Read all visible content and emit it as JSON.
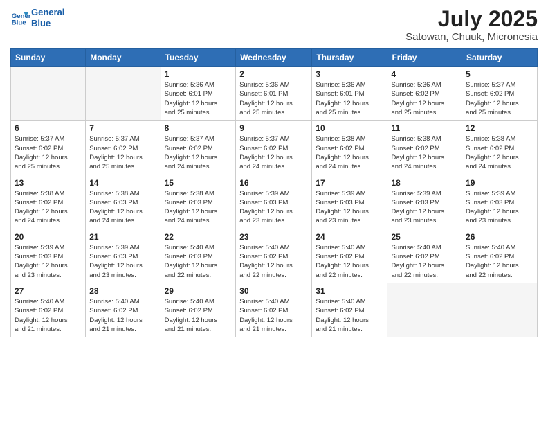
{
  "header": {
    "logo_line1": "General",
    "logo_line2": "Blue",
    "title": "July 2025",
    "subtitle": "Satowan, Chuuk, Micronesia"
  },
  "weekdays": [
    "Sunday",
    "Monday",
    "Tuesday",
    "Wednesday",
    "Thursday",
    "Friday",
    "Saturday"
  ],
  "weeks": [
    [
      {
        "day": "",
        "info": ""
      },
      {
        "day": "",
        "info": ""
      },
      {
        "day": "1",
        "info": "Sunrise: 5:36 AM\nSunset: 6:01 PM\nDaylight: 12 hours\nand 25 minutes."
      },
      {
        "day": "2",
        "info": "Sunrise: 5:36 AM\nSunset: 6:01 PM\nDaylight: 12 hours\nand 25 minutes."
      },
      {
        "day": "3",
        "info": "Sunrise: 5:36 AM\nSunset: 6:01 PM\nDaylight: 12 hours\nand 25 minutes."
      },
      {
        "day": "4",
        "info": "Sunrise: 5:36 AM\nSunset: 6:02 PM\nDaylight: 12 hours\nand 25 minutes."
      },
      {
        "day": "5",
        "info": "Sunrise: 5:37 AM\nSunset: 6:02 PM\nDaylight: 12 hours\nand 25 minutes."
      }
    ],
    [
      {
        "day": "6",
        "info": "Sunrise: 5:37 AM\nSunset: 6:02 PM\nDaylight: 12 hours\nand 25 minutes."
      },
      {
        "day": "7",
        "info": "Sunrise: 5:37 AM\nSunset: 6:02 PM\nDaylight: 12 hours\nand 25 minutes."
      },
      {
        "day": "8",
        "info": "Sunrise: 5:37 AM\nSunset: 6:02 PM\nDaylight: 12 hours\nand 24 minutes."
      },
      {
        "day": "9",
        "info": "Sunrise: 5:37 AM\nSunset: 6:02 PM\nDaylight: 12 hours\nand 24 minutes."
      },
      {
        "day": "10",
        "info": "Sunrise: 5:38 AM\nSunset: 6:02 PM\nDaylight: 12 hours\nand 24 minutes."
      },
      {
        "day": "11",
        "info": "Sunrise: 5:38 AM\nSunset: 6:02 PM\nDaylight: 12 hours\nand 24 minutes."
      },
      {
        "day": "12",
        "info": "Sunrise: 5:38 AM\nSunset: 6:02 PM\nDaylight: 12 hours\nand 24 minutes."
      }
    ],
    [
      {
        "day": "13",
        "info": "Sunrise: 5:38 AM\nSunset: 6:02 PM\nDaylight: 12 hours\nand 24 minutes."
      },
      {
        "day": "14",
        "info": "Sunrise: 5:38 AM\nSunset: 6:03 PM\nDaylight: 12 hours\nand 24 minutes."
      },
      {
        "day": "15",
        "info": "Sunrise: 5:38 AM\nSunset: 6:03 PM\nDaylight: 12 hours\nand 24 minutes."
      },
      {
        "day": "16",
        "info": "Sunrise: 5:39 AM\nSunset: 6:03 PM\nDaylight: 12 hours\nand 23 minutes."
      },
      {
        "day": "17",
        "info": "Sunrise: 5:39 AM\nSunset: 6:03 PM\nDaylight: 12 hours\nand 23 minutes."
      },
      {
        "day": "18",
        "info": "Sunrise: 5:39 AM\nSunset: 6:03 PM\nDaylight: 12 hours\nand 23 minutes."
      },
      {
        "day": "19",
        "info": "Sunrise: 5:39 AM\nSunset: 6:03 PM\nDaylight: 12 hours\nand 23 minutes."
      }
    ],
    [
      {
        "day": "20",
        "info": "Sunrise: 5:39 AM\nSunset: 6:03 PM\nDaylight: 12 hours\nand 23 minutes."
      },
      {
        "day": "21",
        "info": "Sunrise: 5:39 AM\nSunset: 6:03 PM\nDaylight: 12 hours\nand 23 minutes."
      },
      {
        "day": "22",
        "info": "Sunrise: 5:40 AM\nSunset: 6:03 PM\nDaylight: 12 hours\nand 22 minutes."
      },
      {
        "day": "23",
        "info": "Sunrise: 5:40 AM\nSunset: 6:02 PM\nDaylight: 12 hours\nand 22 minutes."
      },
      {
        "day": "24",
        "info": "Sunrise: 5:40 AM\nSunset: 6:02 PM\nDaylight: 12 hours\nand 22 minutes."
      },
      {
        "day": "25",
        "info": "Sunrise: 5:40 AM\nSunset: 6:02 PM\nDaylight: 12 hours\nand 22 minutes."
      },
      {
        "day": "26",
        "info": "Sunrise: 5:40 AM\nSunset: 6:02 PM\nDaylight: 12 hours\nand 22 minutes."
      }
    ],
    [
      {
        "day": "27",
        "info": "Sunrise: 5:40 AM\nSunset: 6:02 PM\nDaylight: 12 hours\nand 21 minutes."
      },
      {
        "day": "28",
        "info": "Sunrise: 5:40 AM\nSunset: 6:02 PM\nDaylight: 12 hours\nand 21 minutes."
      },
      {
        "day": "29",
        "info": "Sunrise: 5:40 AM\nSunset: 6:02 PM\nDaylight: 12 hours\nand 21 minutes."
      },
      {
        "day": "30",
        "info": "Sunrise: 5:40 AM\nSunset: 6:02 PM\nDaylight: 12 hours\nand 21 minutes."
      },
      {
        "day": "31",
        "info": "Sunrise: 5:40 AM\nSunset: 6:02 PM\nDaylight: 12 hours\nand 21 minutes."
      },
      {
        "day": "",
        "info": ""
      },
      {
        "day": "",
        "info": ""
      }
    ]
  ]
}
